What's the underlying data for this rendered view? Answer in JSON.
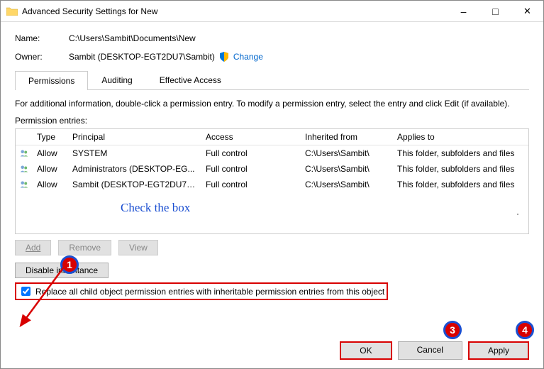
{
  "window": {
    "title": "Advanced Security Settings for New"
  },
  "fields": {
    "name_label": "Name:",
    "name_value": "C:\\Users\\Sambit\\Documents\\New",
    "owner_label": "Owner:",
    "owner_value": "Sambit (DESKTOP-EGT2DU7\\Sambit)",
    "change": "Change"
  },
  "tabs": {
    "permissions": "Permissions",
    "auditing": "Auditing",
    "effective": "Effective Access"
  },
  "info_text": "For additional information, double-click a permission entry. To modify a permission entry, select the entry and click Edit (if available).",
  "entries_label": "Permission entries:",
  "columns": {
    "type": "Type",
    "principal": "Principal",
    "access": "Access",
    "inherited": "Inherited from",
    "applies": "Applies to"
  },
  "rows": [
    {
      "type": "Allow",
      "principal": "SYSTEM",
      "access": "Full control",
      "inherited": "C:\\Users\\Sambit\\",
      "applies": "This folder, subfolders and files"
    },
    {
      "type": "Allow",
      "principal": "Administrators (DESKTOP-EG...",
      "access": "Full control",
      "inherited": "C:\\Users\\Sambit\\",
      "applies": "This folder, subfolders and files"
    },
    {
      "type": "Allow",
      "principal": "Sambit (DESKTOP-EGT2DU7\\S...",
      "access": "Full control",
      "inherited": "C:\\Users\\Sambit\\",
      "applies": "This folder, subfolders and files"
    }
  ],
  "buttons": {
    "add": "Add",
    "remove": "Remove",
    "view": "View",
    "disable_inh": "Disable inheritance",
    "ok": "OK",
    "cancel": "Cancel",
    "apply": "Apply"
  },
  "checkbox_label": "Replace all child object permission entries with inheritable permission entries from this object",
  "annotations": {
    "check_text": "Check the box",
    "b1": "1",
    "b3": "3",
    "b4": "4"
  }
}
